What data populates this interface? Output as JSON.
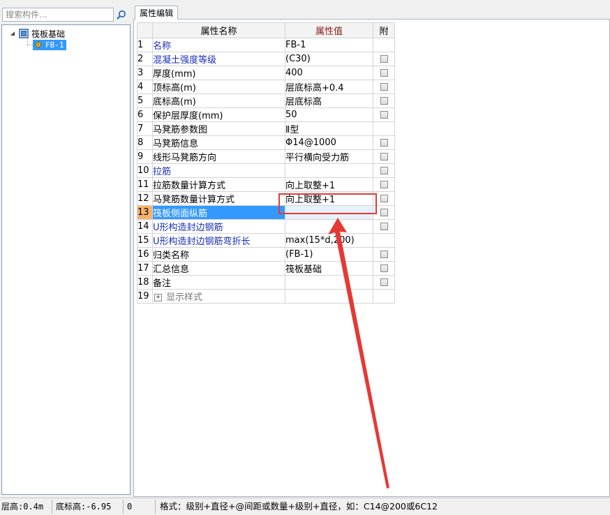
{
  "search": {
    "placeholder": "搜索构件..."
  },
  "tree": {
    "root_label": "筏板基础",
    "child_label": "FB-1"
  },
  "tab_label": "属性编辑",
  "grid": {
    "headers": {
      "name": "属性名称",
      "value": "属性值",
      "attach": "附"
    },
    "rows": [
      {
        "num": "1",
        "name": "名称",
        "value": "FB-1",
        "style": "blue",
        "checkbox": false
      },
      {
        "num": "2",
        "name": "混凝土强度等级",
        "value": "(C30)",
        "style": "blue",
        "checkbox": true
      },
      {
        "num": "3",
        "name": "厚度(mm)",
        "value": "400",
        "style": "",
        "checkbox": true
      },
      {
        "num": "4",
        "name": "顶标高(m)",
        "value": "层底标高+0.4",
        "style": "",
        "checkbox": true
      },
      {
        "num": "5",
        "name": "底标高(m)",
        "value": "层底标高",
        "style": "",
        "checkbox": true
      },
      {
        "num": "6",
        "name": "保护层厚度(mm)",
        "value": "50",
        "style": "",
        "checkbox": true
      },
      {
        "num": "7",
        "name": "马凳筋参数图",
        "value": "Ⅱ型",
        "style": "",
        "checkbox": false
      },
      {
        "num": "8",
        "name": "马凳筋信息",
        "value": "Φ14@1000",
        "style": "",
        "checkbox": true
      },
      {
        "num": "9",
        "name": "线形马凳筋方向",
        "value": "平行横向受力筋",
        "style": "",
        "checkbox": true
      },
      {
        "num": "10",
        "name": "拉筋",
        "value": "",
        "style": "blue",
        "checkbox": true
      },
      {
        "num": "11",
        "name": "拉筋数量计算方式",
        "value": "向上取整+1",
        "style": "",
        "checkbox": true
      },
      {
        "num": "12",
        "name": "马凳筋数量计算方式",
        "value": "向上取整+1",
        "style": "",
        "checkbox": true
      },
      {
        "num": "13",
        "name": "筏板侧面纵筋",
        "value": "",
        "style": "blue",
        "checkbox": true
      },
      {
        "num": "14",
        "name": "U形构造封边钢筋",
        "value": "",
        "style": "blue",
        "checkbox": true
      },
      {
        "num": "15",
        "name": "U形构造封边钢筋弯折长",
        "value": "max(15*d,200)",
        "style": "blue",
        "checkbox": false
      },
      {
        "num": "16",
        "name": "归类名称",
        "value": "(FB-1)",
        "style": "",
        "checkbox": true
      },
      {
        "num": "17",
        "name": "汇总信息",
        "value": "筏板基础",
        "style": "",
        "checkbox": true
      },
      {
        "num": "18",
        "name": "备注",
        "value": "",
        "style": "",
        "checkbox": true
      },
      {
        "num": "19",
        "name": "显示样式",
        "value": "",
        "style": "gray",
        "checkbox": false,
        "expandable": true
      }
    ],
    "selected_row": 13
  },
  "statusbar": {
    "floor_height": "层高:0.4m",
    "bottom_elev": "底标高:-6.95",
    "zero": "0",
    "format_hint": "格式：级别+直径+@间距或数量+级别+直径，如：C14@200或6C12"
  },
  "colors": {
    "selection_blue": "#3399ff",
    "header_orange": "#fbd38a",
    "annotation_red": "#e53935",
    "link_blue": "#1a2fb8"
  }
}
